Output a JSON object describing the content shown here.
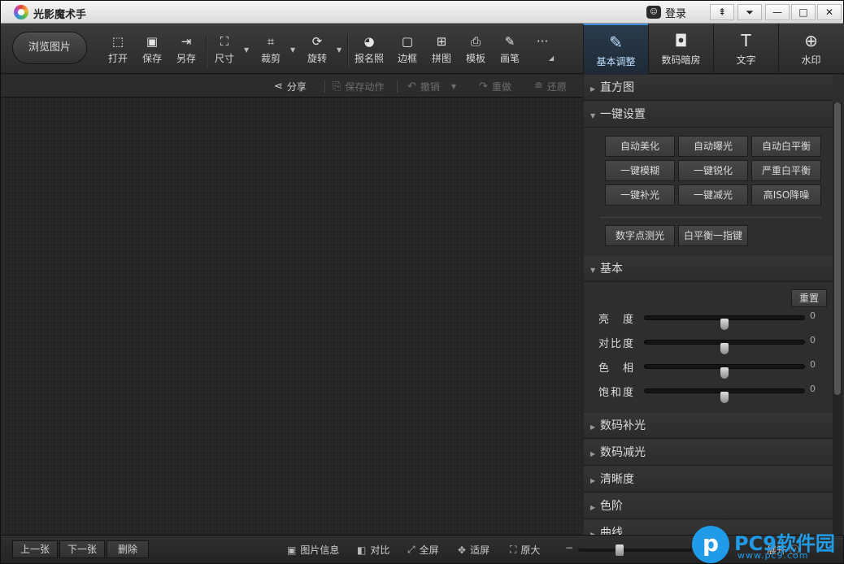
{
  "app": {
    "title": "光影魔术手",
    "login": "登录"
  },
  "window_controls": {
    "skin": "⇞",
    "menu": "⏷",
    "minimize": "—",
    "maximize": "□",
    "close": "✕"
  },
  "toolbar": {
    "browse": "浏览图片",
    "tools": [
      {
        "label": "打开",
        "icon": "⬚"
      },
      {
        "label": "保存",
        "icon": "▣"
      },
      {
        "label": "另存",
        "icon": "⇥"
      },
      {
        "label": "尺寸",
        "icon": "⛶"
      },
      {
        "label": "裁剪",
        "icon": "⌗"
      },
      {
        "label": "旋转",
        "icon": "⟳"
      },
      {
        "label": "报名照",
        "icon": "◕"
      },
      {
        "label": "边框",
        "icon": "▢"
      },
      {
        "label": "拼图",
        "icon": "⊞"
      },
      {
        "label": "模板",
        "icon": "⎙"
      },
      {
        "label": "画笔",
        "icon": "✎"
      },
      {
        "label": "",
        "icon": "···"
      }
    ]
  },
  "right_tabs": [
    {
      "label": "基本调整",
      "icon": "✎",
      "active": true
    },
    {
      "label": "数码暗房",
      "icon": "◘"
    },
    {
      "label": "文字",
      "icon": "T"
    },
    {
      "label": "水印",
      "icon": "⊕"
    }
  ],
  "subbar": {
    "share": "分享",
    "save_action": "保存动作",
    "undo": "撤销",
    "redo": "重做",
    "restore": "还原"
  },
  "panel": {
    "histogram": "直方图",
    "one_click": "一键设置",
    "one_click_buttons": [
      "自动美化",
      "自动曝光",
      "自动白平衡",
      "一键模糊",
      "一键锐化",
      "严重白平衡",
      "一键补光",
      "一键减光",
      "高ISO降噪"
    ],
    "extra_buttons": [
      "数字点测光",
      "白平衡一指键"
    ],
    "basic": "基本",
    "reset": "重置",
    "sliders": [
      {
        "label": "亮　度",
        "value": 0,
        "position": 0.5
      },
      {
        "label": "对比度",
        "value": 0,
        "position": 0.5
      },
      {
        "label": "色　相",
        "value": 0,
        "position": 0.5
      },
      {
        "label": "饱和度",
        "value": 0,
        "position": 0.5
      }
    ],
    "collapsed_sections": [
      "数码补光",
      "数码减光",
      "清晰度",
      "色阶",
      "曲线"
    ]
  },
  "bottom": {
    "prev": "上一张",
    "next": "下一张",
    "delete": "删除",
    "info": "图片信息",
    "compare": "对比",
    "fullscreen": "全屏",
    "fit": "适屏",
    "original": "原大",
    "zoom_position": 0.35,
    "expand": "展开"
  },
  "watermark": {
    "mark": "p",
    "text": "PC9软件园",
    "url": "www.pc9.com"
  }
}
